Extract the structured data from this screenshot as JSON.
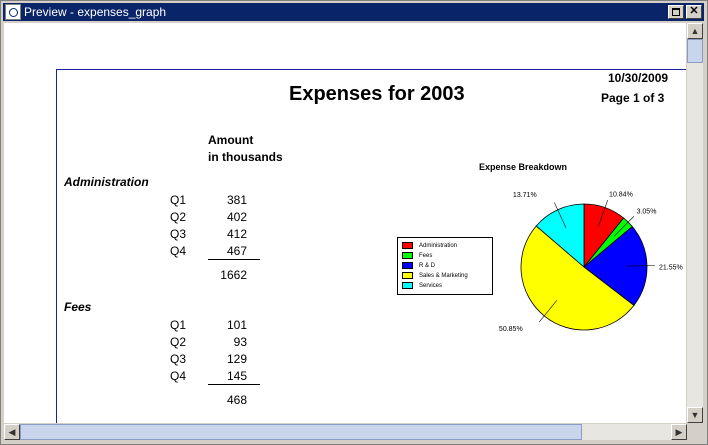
{
  "window": {
    "title": "Preview - expenses_graph"
  },
  "report": {
    "date": "10/30/2009",
    "page": "Page 1 of 3",
    "title": "Expenses for  2003",
    "amount_header_line1": "Amount",
    "amount_header_line2": "in thousands",
    "groups": [
      {
        "name": "Administration",
        "rows": [
          {
            "q": "Q1",
            "v": "381"
          },
          {
            "q": "Q2",
            "v": "402"
          },
          {
            "q": "Q3",
            "v": "412"
          },
          {
            "q": "Q4",
            "v": "467"
          }
        ],
        "total": "1662"
      },
      {
        "name": "Fees",
        "rows": [
          {
            "q": "Q1",
            "v": "101"
          },
          {
            "q": "Q2",
            "v": "93"
          },
          {
            "q": "Q3",
            "v": "129"
          },
          {
            "q": "Q4",
            "v": "145"
          }
        ],
        "total": "468"
      }
    ]
  },
  "chart_data": {
    "type": "pie",
    "title": "Expense Breakdown",
    "legend_position": "left",
    "categories": [
      "Administration",
      "Fees",
      "R & D",
      "Sales & Marketing",
      "Services"
    ],
    "values": [
      10.84,
      3.05,
      21.55,
      50.85,
      13.71
    ],
    "labels": [
      "10.84%",
      "3.05%",
      "21.55%",
      "50.85%",
      "13.71%"
    ],
    "colors": [
      "#ff0000",
      "#00ff00",
      "#0000ff",
      "#ffff00",
      "#00ffff"
    ]
  }
}
